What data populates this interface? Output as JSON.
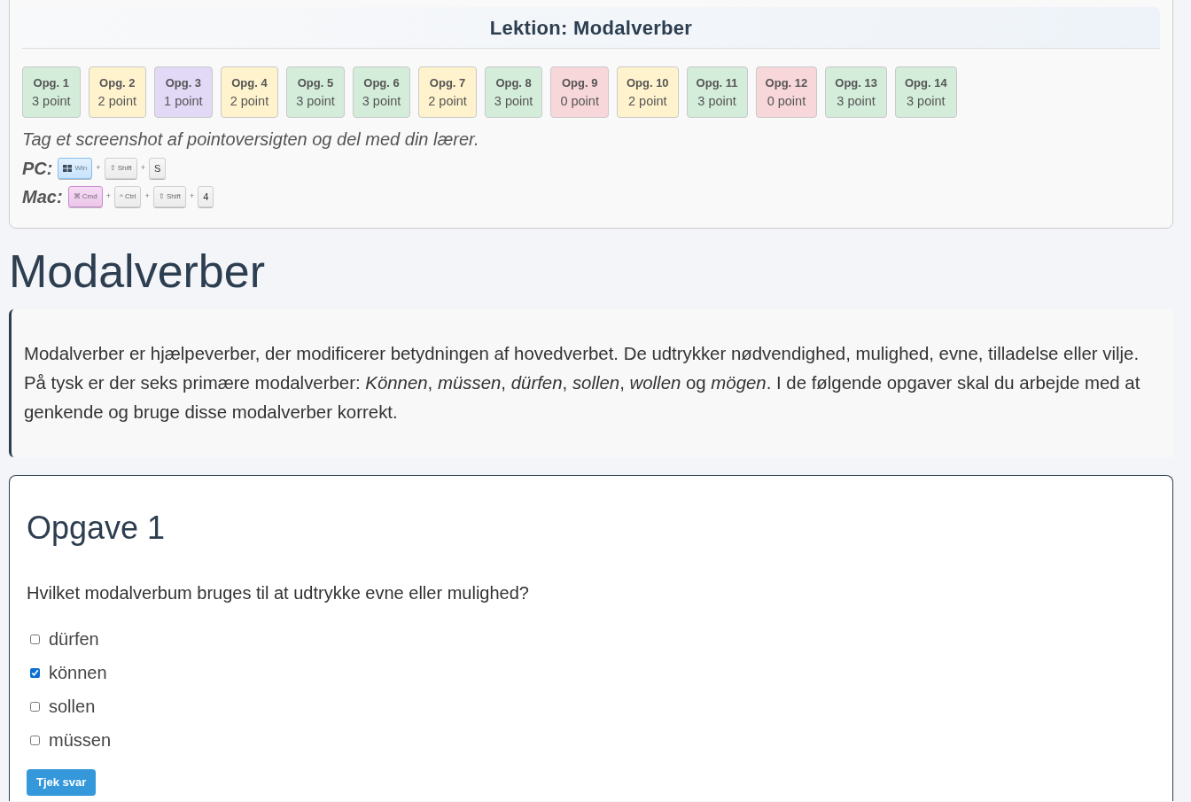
{
  "lesson_panel": {
    "title": "Lektion: Modalverber",
    "scores": [
      {
        "label": "Opg. 1",
        "points": "3 point",
        "color": "#d4edda"
      },
      {
        "label": "Opg. 2",
        "points": "2 point",
        "color": "#fff3cd"
      },
      {
        "label": "Opg. 3",
        "points": "1 point",
        "color": "#e2d9f7"
      },
      {
        "label": "Opg. 4",
        "points": "2 point",
        "color": "#fff3cd"
      },
      {
        "label": "Opg. 5",
        "points": "3 point",
        "color": "#d4edda"
      },
      {
        "label": "Opg. 6",
        "points": "3 point",
        "color": "#d4edda"
      },
      {
        "label": "Opg. 7",
        "points": "2 point",
        "color": "#fff3cd"
      },
      {
        "label": "Opg. 8",
        "points": "3 point",
        "color": "#d4edda"
      },
      {
        "label": "Opg. 9",
        "points": "0 point",
        "color": "#f8d7da"
      },
      {
        "label": "Opg. 10",
        "points": "2 point",
        "color": "#fff3cd"
      },
      {
        "label": "Opg. 11",
        "points": "3 point",
        "color": "#d4edda"
      },
      {
        "label": "Opg. 12",
        "points": "0 point",
        "color": "#f8d7da"
      },
      {
        "label": "Opg. 13",
        "points": "3 point",
        "color": "#d4edda"
      },
      {
        "label": "Opg. 14",
        "points": "3 point",
        "color": "#d4edda"
      }
    ],
    "instruction": "Tag et screenshot af pointoversigten og del med din lærer.",
    "shortcuts": [
      {
        "platform": "PC:",
        "keys": [
          {
            "kind": "win",
            "label": "Win"
          },
          {
            "kind": "plain",
            "joiner": "+",
            "label": "⇧ Shift"
          },
          {
            "kind": "plain",
            "joiner": "+",
            "label": "S"
          }
        ]
      },
      {
        "platform": "Mac:",
        "keys": [
          {
            "kind": "cmd",
            "label": "⌘ Cmd"
          },
          {
            "kind": "plain",
            "joiner": "+",
            "label": "^ Ctrl"
          },
          {
            "kind": "plain",
            "joiner": "+",
            "label": "⇧ Shift"
          },
          {
            "kind": "plain",
            "joiner": "+",
            "label": "4"
          }
        ]
      }
    ]
  },
  "heading": "Modalverber",
  "intro": "Modalverber er hjælpeverber, der modificerer betydningen af hovedverbet. De udtrykker nødvendighed, mulighed, evne, tilladelse eller vilje. På tysk er der seks primære modalverber: *Können*, *müssen*, *dürfen*, *sollen*, *wollen* og *mögen*. I de følgende opgaver skal du arbejde med at genkende og bruge disse modalverber korrekt.",
  "task": {
    "title": "Opgave 1",
    "question": "Hvilket modalverbum bruges til at udtrykke evne eller mulighed?",
    "options": [
      {
        "label": "dürfen",
        "checked": false
      },
      {
        "label": "können",
        "checked": true
      },
      {
        "label": "sollen",
        "checked": false
      },
      {
        "label": "müssen",
        "checked": false
      }
    ],
    "button": "Tjek svar"
  }
}
